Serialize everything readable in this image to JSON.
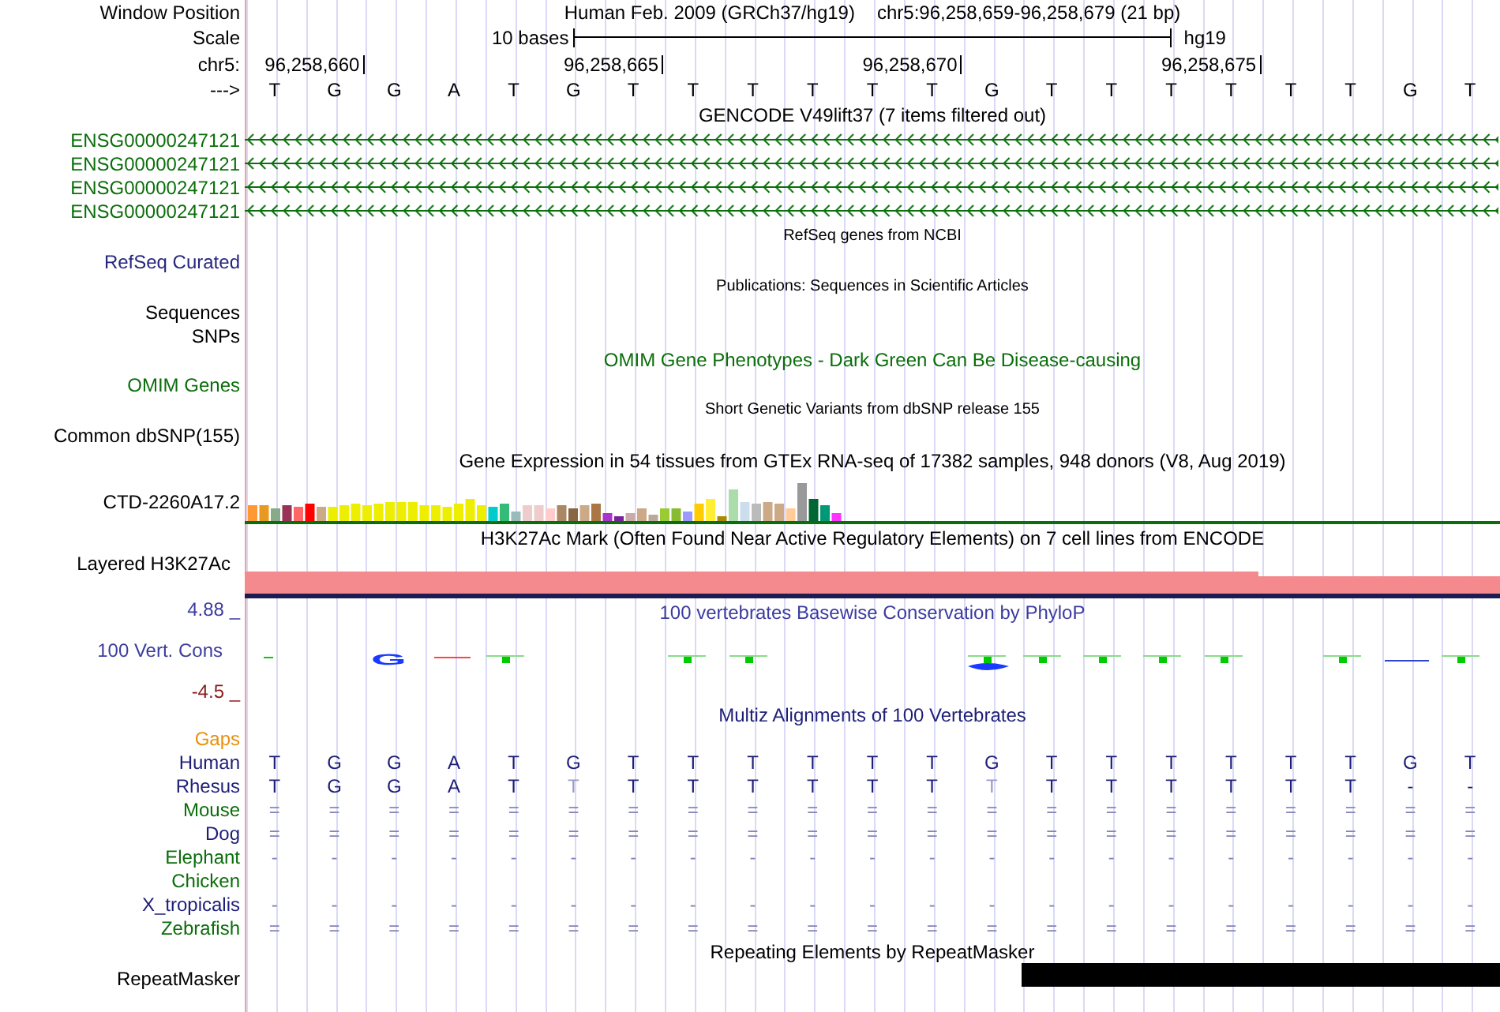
{
  "header": {
    "window_position_label": "Window Position",
    "assembly": "Human Feb. 2009 (GRCh37/hg19)",
    "position": "chr5:96,258,659-96,258,679 (21 bp)",
    "scale_label": "Scale",
    "scale_text": "10 bases",
    "scale_db": "hg19",
    "chrom_label": "chr5:",
    "ruler_ticks": [
      "96,258,660",
      "96,258,665",
      "96,258,670",
      "96,258,675"
    ],
    "strand_label": "--->",
    "bases": [
      "T",
      "G",
      "G",
      "A",
      "T",
      "G",
      "T",
      "T",
      "T",
      "T",
      "T",
      "T",
      "G",
      "T",
      "T",
      "T",
      "T",
      "T",
      "T",
      "G",
      "T"
    ]
  },
  "tracks": [
    {
      "kind": "genes",
      "title": "GENCODE V49lift37 (7 items filtered out)",
      "color": "#0a6e0a",
      "items": [
        "ENSG00000247121",
        "ENSG00000247121",
        "ENSG00000247121",
        "ENSG00000247121"
      ]
    },
    {
      "kind": "simple",
      "small": true,
      "title": {
        "text": "RefSeq genes from NCBI",
        "color": "#000000"
      },
      "color": "#26267f",
      "labels": [
        "RefSeq Curated"
      ]
    },
    {
      "kind": "simple",
      "small": true,
      "title": {
        "text": "Publications: Sequences in Scientific Articles",
        "color": "#000000"
      },
      "color": "#000000",
      "labels": [
        "Sequences",
        "SNPs"
      ]
    },
    {
      "kind": "simple",
      "small": false,
      "title": {
        "text": "OMIM Gene Phenotypes - Dark Green Can Be Disease-causing",
        "color": "#0a6e0a"
      },
      "color": "#0a6e0a",
      "labels": [
        "OMIM Genes"
      ]
    },
    {
      "kind": "simple",
      "small": true,
      "title": {
        "text": "Short Genetic Variants from dbSNP release 155",
        "color": "#000000"
      },
      "color": "#000000",
      "labels": [
        "Common dbSNP(155)"
      ]
    },
    {
      "kind": "gtex",
      "title": "Gene Expression in 54 tissues from GTEx RNA-seq of 17382 samples, 948 donors (V8, Aug 2019)",
      "label": "CTD-2260A17.2"
    },
    {
      "kind": "layered",
      "title": "H3K27Ac Mark (Often Found Near Active Regulatory Elements) on 7 cell lines from ENCODE",
      "label": "Layered H3K27Ac"
    },
    {
      "kind": "phylop",
      "title": "100 vertebrates Basewise Conservation by PhyloP",
      "label": "100 Vert. Cons",
      "max": "4.88 _",
      "min": "-4.5 _",
      "logo_letter": "G"
    },
    {
      "kind": "multiz",
      "title": "Multiz Alignments of 100 Vertebrates",
      "species": [
        {
          "name": "Gaps",
          "color": "#e8900c",
          "kind": "empty"
        },
        {
          "name": "Human",
          "color": "#1e1e78",
          "kind": "sequence",
          "bases": [
            "T",
            "G",
            "G",
            "A",
            "T",
            "G",
            "T",
            "T",
            "T",
            "T",
            "T",
            "T",
            "G",
            "T",
            "T",
            "T",
            "T",
            "T",
            "T",
            "G",
            "T"
          ]
        },
        {
          "name": "Rhesus",
          "color": "#1e1e78",
          "kind": "sequence",
          "bases": [
            "T",
            "G",
            "G",
            "A",
            "T",
            {
              "text": "T",
              "faded": true
            },
            "T",
            "T",
            "T",
            "T",
            "T",
            "T",
            {
              "text": "T",
              "faded": true
            },
            "T",
            "T",
            "T",
            "T",
            "T",
            "T",
            "-",
            "-"
          ]
        },
        {
          "name": "Mouse",
          "color": "#0a6e0a",
          "kind": "summary",
          "bases": [
            "=",
            "=",
            "=",
            "=",
            "=",
            "=",
            "=",
            "=",
            "=",
            "=",
            "=",
            "=",
            "=",
            "=",
            "=",
            "=",
            "=",
            "=",
            "=",
            "=",
            "="
          ]
        },
        {
          "name": "Dog",
          "color": "#1e1e78",
          "kind": "summary",
          "bases": [
            "=",
            "=",
            "=",
            "=",
            "=",
            "=",
            "=",
            "=",
            "=",
            "=",
            "=",
            "=",
            "=",
            "=",
            "=",
            "=",
            "=",
            "=",
            "=",
            "=",
            "="
          ]
        },
        {
          "name": "Elephant",
          "color": "#0a6e0a",
          "kind": "summary",
          "bases": [
            "-",
            "-",
            "-",
            "-",
            "-",
            "-",
            "-",
            "-",
            "-",
            "-",
            "-",
            "-",
            "-",
            "-",
            "-",
            "-",
            "-",
            "-",
            "-",
            "-",
            "-"
          ]
        },
        {
          "name": "Chicken",
          "color": "#0a6e0a",
          "kind": "empty"
        },
        {
          "name": "X_tropicalis",
          "color": "#1e1e78",
          "kind": "summary",
          "bases": [
            "-",
            "-",
            "-",
            "-",
            "-",
            "-",
            "-",
            "-",
            "-",
            "-",
            "-",
            "-",
            "-",
            "-",
            "-",
            "-",
            "-",
            "-",
            "-",
            "-",
            "-"
          ]
        },
        {
          "name": "Zebrafish",
          "color": "#0a6e0a",
          "kind": "summary",
          "bases": [
            "=",
            "=",
            "=",
            "=",
            "=",
            "=",
            "=",
            "=",
            "=",
            "=",
            "=",
            "=",
            "=",
            "=",
            "=",
            "=",
            "=",
            "=",
            "=",
            "=",
            "="
          ]
        }
      ]
    },
    {
      "kind": "repeatmasker",
      "title": "Repeating Elements by RepeatMasker",
      "label": "RepeatMasker"
    }
  ]
}
